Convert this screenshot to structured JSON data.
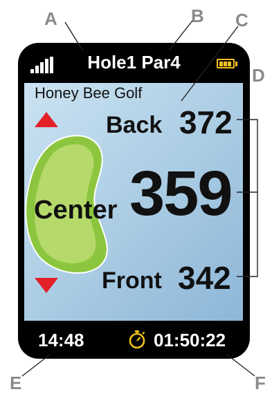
{
  "callouts": {
    "a": "A",
    "b": "B",
    "c": "C",
    "d": "D",
    "e": "E",
    "f": "F"
  },
  "header": {
    "hole_title": "Hole1 Par4",
    "signal_icon": "signal-bars-icon",
    "battery_icon": "battery-icon"
  },
  "course": {
    "name": "Honey Bee Golf"
  },
  "distances": {
    "back": {
      "label": "Back",
      "value": "372"
    },
    "center": {
      "label": "Center",
      "value": "359"
    },
    "front": {
      "label": "Front",
      "value": "342"
    }
  },
  "footer": {
    "time": "14:48",
    "stopwatch_icon": "stopwatch-icon",
    "elapsed": "01:50:22"
  },
  "colors": {
    "screen_bg": "#a9cbe3",
    "green": "#8cc63f",
    "green_light": "#b5d96a",
    "arrow": "#e32028",
    "battery": "#f2c01e"
  }
}
